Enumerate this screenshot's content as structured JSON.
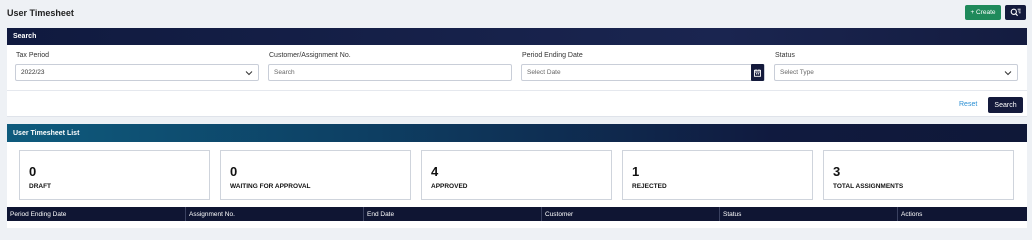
{
  "page": {
    "title": "User Timesheet",
    "create_label": "+ Create",
    "filter_icon": "filter-search-icon"
  },
  "search": {
    "header": "Search",
    "fields": [
      {
        "label": "Tax Period",
        "value": "2022/23",
        "type": "select"
      },
      {
        "label": "Customer/Assignment No.",
        "placeholder": "Search",
        "type": "text"
      },
      {
        "label": "Period Ending Date",
        "placeholder": "Select Date",
        "type": "date"
      },
      {
        "label": "Status",
        "placeholder": "Select Type",
        "type": "select"
      }
    ],
    "reset_label": "Reset",
    "search_label": "Search"
  },
  "list": {
    "header": "User Timesheet List",
    "stats": [
      {
        "value": "0",
        "label": "DRAFT"
      },
      {
        "value": "0",
        "label": "WAITING FOR APPROVAL"
      },
      {
        "value": "4",
        "label": "APPROVED"
      },
      {
        "value": "1",
        "label": "REJECTED"
      },
      {
        "value": "3",
        "label": "TOTAL ASSIGNMENTS"
      }
    ],
    "columns": [
      "Period Ending Date",
      "Assignment No.",
      "End Date",
      "Customer",
      "Status",
      "Actions"
    ]
  },
  "colors": {
    "primary_dark": "#141a3c",
    "create_green": "#1f8a5b",
    "link_blue": "#2a8fd4"
  }
}
